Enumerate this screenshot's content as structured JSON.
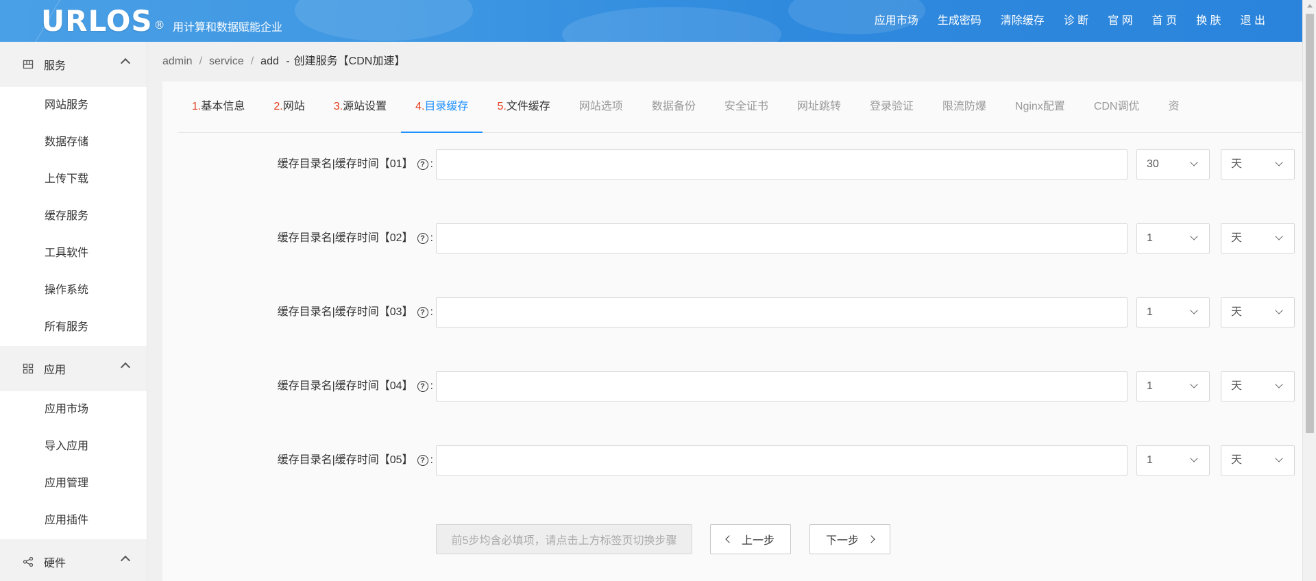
{
  "header": {
    "brand": "URLOS",
    "brand_mark": "®",
    "tagline": "用计算和数据赋能企业",
    "nav": [
      "应用市场",
      "生成密码",
      "清除缓存",
      "诊 断",
      "官 网",
      "首 页",
      "换 肤",
      "退 出"
    ],
    "colors": {
      "bar": "#3d96e2"
    }
  },
  "sidebar": {
    "groups": [
      {
        "label": "服务",
        "icon": "service-grid-icon",
        "items": [
          "网站服务",
          "数据存储",
          "上传下载",
          "缓存服务",
          "工具软件",
          "操作系统",
          "所有服务"
        ]
      },
      {
        "label": "应用",
        "icon": "apps-grid-icon",
        "items": [
          "应用市场",
          "导入应用",
          "应用管理",
          "应用插件"
        ]
      },
      {
        "label": "硬件",
        "icon": "share-nodes-icon",
        "items": []
      }
    ]
  },
  "breadcrumb": {
    "parts": [
      "admin",
      "service",
      "add"
    ],
    "separator": "/",
    "dash": "-",
    "current": "创建服务【CDN加速】"
  },
  "tabs": [
    {
      "num": "1.",
      "label": "基本信息",
      "state": "done"
    },
    {
      "num": "2.",
      "label": "网站",
      "state": "done"
    },
    {
      "num": "3.",
      "label": "源站设置",
      "state": "done"
    },
    {
      "num": "4.",
      "label": "目录缓存",
      "state": "active"
    },
    {
      "num": "5.",
      "label": "文件缓存",
      "state": "done"
    },
    {
      "num": "",
      "label": "网站选项",
      "state": "todo"
    },
    {
      "num": "",
      "label": "数据备份",
      "state": "todo"
    },
    {
      "num": "",
      "label": "安全证书",
      "state": "todo"
    },
    {
      "num": "",
      "label": "网址跳转",
      "state": "todo"
    },
    {
      "num": "",
      "label": "登录验证",
      "state": "todo"
    },
    {
      "num": "",
      "label": "限流防爆",
      "state": "todo"
    },
    {
      "num": "",
      "label": "Nginx配置",
      "state": "todo"
    },
    {
      "num": "",
      "label": "CDN调优",
      "state": "todo"
    },
    {
      "num": "",
      "label": "资",
      "state": "todo"
    }
  ],
  "form": {
    "rows": [
      {
        "label": "缓存目录名|缓存时间【01】",
        "help": "?",
        "colon": ":",
        "value": "",
        "amount": "30",
        "unit": "天"
      },
      {
        "label": "缓存目录名|缓存时间【02】",
        "help": "?",
        "colon": ":",
        "value": "",
        "amount": "1",
        "unit": "天"
      },
      {
        "label": "缓存目录名|缓存时间【03】",
        "help": "?",
        "colon": ":",
        "value": "",
        "amount": "1",
        "unit": "天"
      },
      {
        "label": "缓存目录名|缓存时间【04】",
        "help": "?",
        "colon": ":",
        "value": "",
        "amount": "1",
        "unit": "天"
      },
      {
        "label": "缓存目录名|缓存时间【05】",
        "help": "?",
        "colon": ":",
        "value": "",
        "amount": "1",
        "unit": "天"
      }
    ]
  },
  "footer": {
    "hint": "前5步均含必填项，请点击上方标签页切换步骤",
    "prev": "上一步",
    "next": "下一步"
  }
}
